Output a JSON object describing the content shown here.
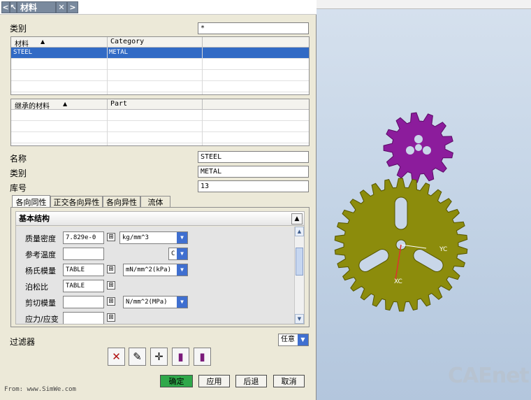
{
  "dialog": {
    "title": "材料",
    "nav_back": "<",
    "close": "✕",
    "nav_forward": ">"
  },
  "search": {
    "category_label": "类别",
    "category_filter": "*"
  },
  "materials_table": {
    "columns": [
      "材料",
      "Category"
    ],
    "rows": [
      {
        "name": "STEEL",
        "category": "METAL"
      }
    ]
  },
  "inherited_table": {
    "columns": [
      "继承的材料",
      "Part"
    ]
  },
  "properties": {
    "name_label": "名称",
    "name_value": "STEEL",
    "category_label": "类别",
    "category_value": "METAL",
    "library_label": "库号",
    "library_value": "13"
  },
  "tabs": [
    "各向同性",
    "正交各向异性",
    "各向异性",
    "流体"
  ],
  "section": {
    "title": "基本结构",
    "rows": [
      {
        "label": "质量密度",
        "value": "7.829e-0",
        "unit": "kg/mm^3"
      },
      {
        "label": "参考温度",
        "value": "",
        "unit": "C"
      },
      {
        "label": "杨氏模量",
        "value": "TABLE",
        "unit": "mN/mm^2(kPa)"
      },
      {
        "label": "泊松比",
        "value": "TABLE",
        "unit": ""
      },
      {
        "label": "剪切模量",
        "value": "",
        "unit": "N/mm^2(MPa)"
      },
      {
        "label": "应力/应变",
        "value": "",
        "unit": ""
      }
    ]
  },
  "filter": {
    "label": "过滤器",
    "value": "任意"
  },
  "buttons": {
    "ok": "确定",
    "apply": "应用",
    "back": "后退",
    "cancel": "取消"
  },
  "credit": "From: www.SimWe.com",
  "viewport": {
    "watermark": "CAEnet",
    "axis_xc": "XC",
    "axis_yc": "YC",
    "gear_large_color": "#8c8c0c",
    "gear_small_color": "#8c1c9c"
  }
}
